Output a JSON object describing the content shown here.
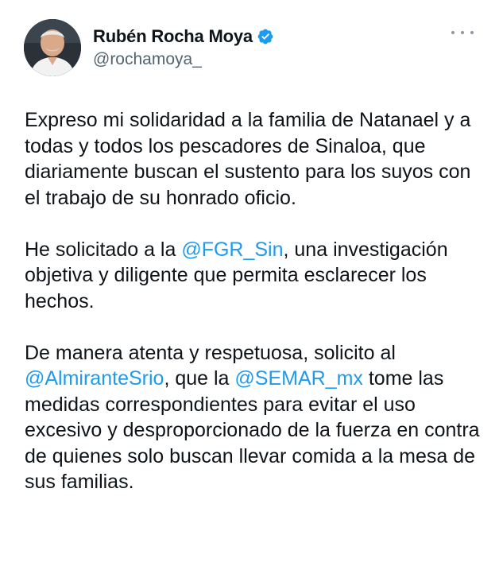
{
  "author": {
    "display_name": "Rubén Rocha Moya",
    "handle": "@rochamoya_",
    "verified": true,
    "avatar_icon": "profile-photo"
  },
  "menu": {
    "icon": "more-horizontal-icon"
  },
  "colors": {
    "mention": "#1d9bf0",
    "text": "#0f1419",
    "secondary": "#536471",
    "verified_badge": "#1d9bf0"
  },
  "tweet": {
    "p1": "Expreso mi solidaridad a la familia de Natanael y a todas y todos los pescadores de Sinaloa, que diariamente buscan el sustento para los suyos con el trabajo de su honrado oficio.",
    "p2_before": "He solicitado a la ",
    "p2_mention": "@FGR_Sin",
    "p2_after": ", una investigación objetiva y diligente que permita esclarecer los hechos.",
    "p3_before": "De manera atenta y respetuosa, solicito al ",
    "p3_mention1": "@AlmiranteSrio",
    "p3_middle": ", que la ",
    "p3_mention2": "@SEMAR_mx",
    "p3_after": " tome las medidas correspondientes para evitar el uso excesivo y desproporcionado de la fuerza en contra de quienes solo buscan llevar comida a la mesa de sus familias."
  }
}
